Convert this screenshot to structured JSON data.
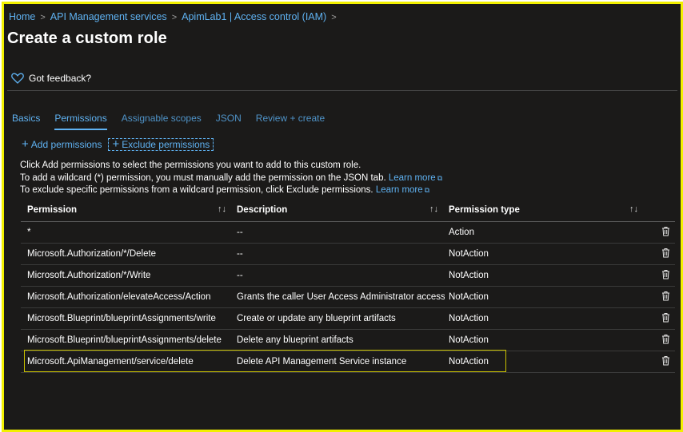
{
  "breadcrumb": {
    "items": [
      "Home",
      "API Management services",
      "ApimLab1 | Access control (IAM)"
    ],
    "separator": ">"
  },
  "page": {
    "title": "Create a custom role",
    "feedback_label": "Got feedback?"
  },
  "tabs": [
    {
      "label": "Basics"
    },
    {
      "label": "Permissions"
    },
    {
      "label": "Assignable scopes"
    },
    {
      "label": "JSON"
    },
    {
      "label": "Review + create"
    }
  ],
  "active_tab": "Permissions",
  "actions": {
    "add_label": "Add permissions",
    "exclude_label": "Exclude permissions"
  },
  "info": {
    "line1": "Click Add permissions to select the permissions you want to add to this custom role.",
    "line2": "To add a wildcard (*) permission, you must manually add the permission on the JSON tab.",
    "line3": "To exclude specific permissions from a wildcard permission, click Exclude permissions.",
    "learn_more": "Learn more"
  },
  "table": {
    "columns": [
      "Permission",
      "Description",
      "Permission type"
    ],
    "sort_glyph": "↑↓",
    "rows": [
      {
        "permission": "*",
        "description": "--",
        "type": "Action"
      },
      {
        "permission": "Microsoft.Authorization/*/Delete",
        "description": "--",
        "type": "NotAction"
      },
      {
        "permission": "Microsoft.Authorization/*/Write",
        "description": "--",
        "type": "NotAction"
      },
      {
        "permission": "Microsoft.Authorization/elevateAccess/Action",
        "description": "Grants the caller User Access Administrator access ...",
        "type": "NotAction"
      },
      {
        "permission": "Microsoft.Blueprint/blueprintAssignments/write",
        "description": "Create or update any blueprint artifacts",
        "type": "NotAction"
      },
      {
        "permission": "Microsoft.Blueprint/blueprintAssignments/delete",
        "description": "Delete any blueprint artifacts",
        "type": "NotAction"
      },
      {
        "permission": "Microsoft.ApiManagement/service/delete",
        "description": "Delete API Management Service instance",
        "type": "NotAction"
      }
    ]
  },
  "colors": {
    "background": "#1b1a19",
    "accent": "#5fb2f2",
    "highlight_border": "#f2f000"
  }
}
